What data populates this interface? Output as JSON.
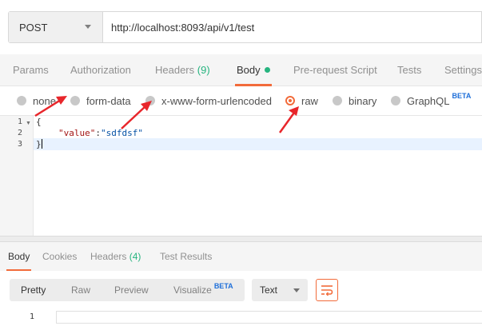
{
  "request": {
    "method": "POST",
    "url": "http://localhost:8093/api/v1/test"
  },
  "tabs": {
    "params": "Params",
    "authorization": "Authorization",
    "headers": "Headers",
    "headers_count": "(9)",
    "body": "Body",
    "pre_request": "Pre-request Script",
    "tests": "Tests",
    "settings": "Settings"
  },
  "body_types": {
    "none": "none",
    "form_data": "form-data",
    "urlencoded": "x-www-form-urlencoded",
    "raw": "raw",
    "binary": "binary",
    "graphql": "GraphQL",
    "graphql_badge": "BETA",
    "selected": "raw"
  },
  "editor": {
    "line_numbers": [
      "1",
      "2",
      "3"
    ],
    "line1": "{",
    "line2_key": "\"value\"",
    "line2_colon": ":",
    "line2_value": "\"sdfdsf\"",
    "line3": "}"
  },
  "response_tabs": {
    "body": "Body",
    "cookies": "Cookies",
    "headers": "Headers",
    "headers_count": "(4)",
    "test_results": "Test Results"
  },
  "response_toolbar": {
    "pretty": "Pretty",
    "raw": "Raw",
    "preview": "Preview",
    "visualize": "Visualize",
    "visualize_badge": "BETA",
    "format": "Text"
  },
  "response_body": {
    "line_number": "1"
  },
  "colors": {
    "accent": "#f26b3a",
    "green": "#26b47f",
    "annotation_red": "#e8262b"
  }
}
